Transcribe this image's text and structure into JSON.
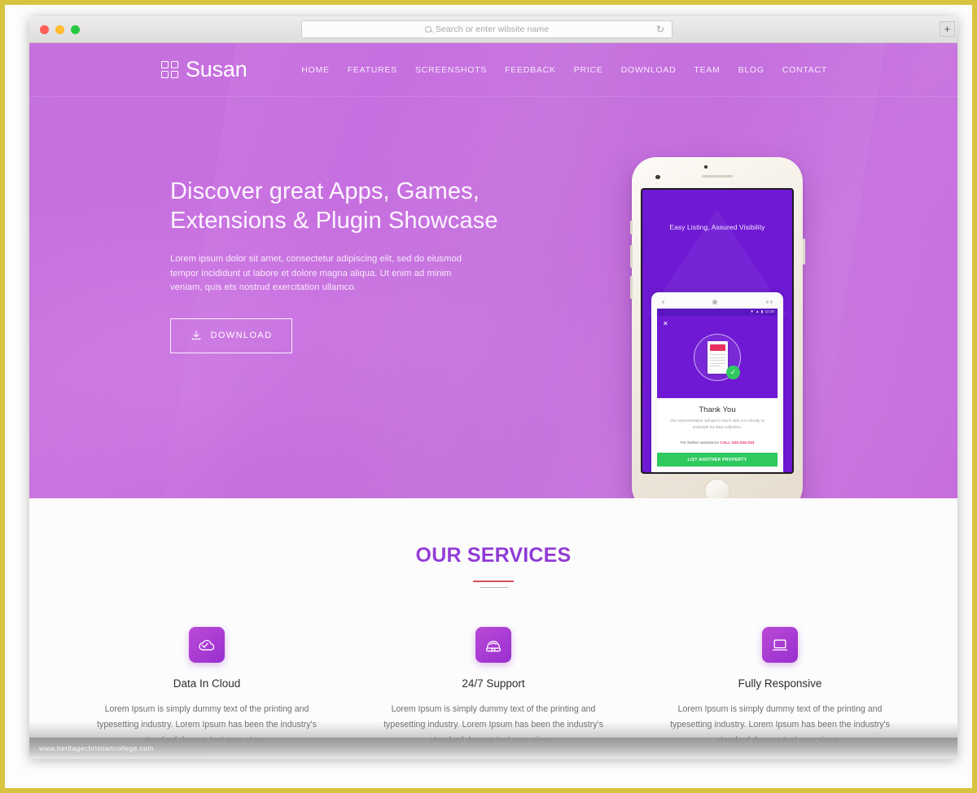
{
  "browser": {
    "traffic_lights": [
      "close",
      "minimize",
      "maximize"
    ],
    "address_placeholder": "Search or enter wibsite name",
    "reload_icon": "reload-icon",
    "new_tab_label": "+"
  },
  "site": {
    "brand": "Susan",
    "nav": [
      {
        "label": "HOME"
      },
      {
        "label": "FEATURES"
      },
      {
        "label": "SCREENSHOTS"
      },
      {
        "label": "FEEDBACK"
      },
      {
        "label": "PRICE"
      },
      {
        "label": "DOWNLOAD"
      },
      {
        "label": "TEAM"
      },
      {
        "label": "BLOG"
      },
      {
        "label": "CONTACT"
      }
    ]
  },
  "hero": {
    "title_line1": "Discover great Apps, Games,",
    "title_line2": "Extensions & Plugin Showcase",
    "paragraph": "Lorem ipsum dolor sit amet, consectetur adipiscing elit, sed do eiusmod tempor incididunt ut labore et dolore magna aliqua. Ut enim ad minim veniam, quis ets nostrud exercitation ullamco.",
    "cta_label": "DOWNLOAD",
    "cta_icon": "download-icon",
    "bg_color": "#c571dd"
  },
  "phone": {
    "screen_tagline": "Easy Listing, Assured Visibility",
    "screen_bg": "#6f19d4",
    "inner_app": {
      "close_icon": "close-icon",
      "status_icons": [
        "wifi-icon",
        "signal-icon",
        "battery-icon"
      ],
      "status_time": "12:30",
      "check_icon": "check-circle-icon",
      "title": "Thank You",
      "body": "Our representative will get in touch with you shortly to schedule for data collection.",
      "assist_prefix": "For further assistance ",
      "assist_highlight": "CALL 333-333-333",
      "button_label": "LIST ANOTHER PROPERTY",
      "button_color": "#2ec95f"
    }
  },
  "services": {
    "heading": "OUR SERVICES",
    "accent_color": "#a83ad4",
    "divider_color": "#d5505f",
    "cards": [
      {
        "icon": "cloud-icon",
        "title": "Data In Cloud",
        "text": "Lorem Ipsum is simply dummy text of the printing and typesetting industry. Lorem Ipsum has been the industry's standard dummy text ever since ."
      },
      {
        "icon": "telephone-icon",
        "title": "24/7 Support",
        "text": "Lorem Ipsum is simply dummy text of the printing and typesetting industry. Lorem Ipsum has been the industry's standard dummy text ever since ."
      },
      {
        "icon": "laptop-icon",
        "title": "Fully Responsive",
        "text": "Lorem Ipsum is simply dummy text of the printing and typesetting industry. Lorem Ipsum has been the industry's standard dummy text ever since ."
      }
    ]
  },
  "watermark": {
    "text": "www.heritagechristiancollege.com"
  }
}
